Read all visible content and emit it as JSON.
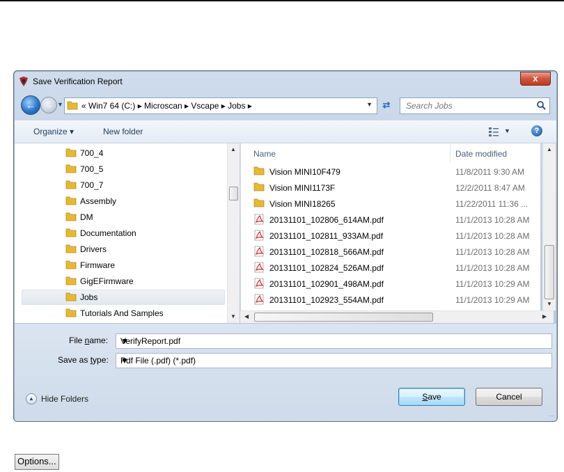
{
  "window": {
    "title": "Save Verification Report",
    "close_label": "x"
  },
  "address_bar": {
    "path": "«  Win7 64 (C:)  ▸  Microscan  ▸  Vscape  ▸  Jobs  ▸"
  },
  "search": {
    "placeholder": "Search Jobs"
  },
  "toolbar": {
    "organize_label": "Organize ▾",
    "new_folder_label": "New folder"
  },
  "nav_pane": {
    "items": [
      {
        "label": "700_4"
      },
      {
        "label": "700_5"
      },
      {
        "label": "700_7"
      },
      {
        "label": "Assembly"
      },
      {
        "label": "DM"
      },
      {
        "label": "Documentation"
      },
      {
        "label": "Drivers"
      },
      {
        "label": "Firmware"
      },
      {
        "label": "GigEFirmware"
      },
      {
        "label": "Jobs",
        "selected": true
      },
      {
        "label": "Tutorials And Samples"
      }
    ]
  },
  "file_list": {
    "columns": {
      "name": "Name",
      "date": "Date modified"
    },
    "rows": [
      {
        "name": "Vision MINI10F479",
        "date": "11/8/2011 9:30 AM",
        "type": "folder"
      },
      {
        "name": "Vision MINI1173F",
        "date": "12/2/2011 8:47 AM",
        "type": "folder"
      },
      {
        "name": "Vision MINI18265",
        "date": "11/22/2011 11:36 ...",
        "type": "folder"
      },
      {
        "name": "20131101_102806_614AM.pdf",
        "date": "11/1/2013 10:28 AM",
        "type": "pdf"
      },
      {
        "name": "20131101_102811_933AM.pdf",
        "date": "11/1/2013 10:28 AM",
        "type": "pdf"
      },
      {
        "name": "20131101_102818_566AM.pdf",
        "date": "11/1/2013 10:28 AM",
        "type": "pdf"
      },
      {
        "name": "20131101_102824_526AM.pdf",
        "date": "11/1/2013 10:28 AM",
        "type": "pdf"
      },
      {
        "name": "20131101_102901_498AM.pdf",
        "date": "11/1/2013 10:29 AM",
        "type": "pdf"
      },
      {
        "name": "20131101_102923_554AM.pdf",
        "date": "11/1/2013 10:29 AM",
        "type": "pdf"
      }
    ]
  },
  "form": {
    "file_name_label_pre": "File ",
    "file_name_label_key": "n",
    "file_name_label_post": "ame:",
    "file_name_value": "VerifyReport.pdf",
    "save_type_label_pre": "Save as ",
    "save_type_label_key": "t",
    "save_type_label_post": "ype:",
    "save_type_value": "Pdf File (.pdf) (*.pdf)"
  },
  "footer": {
    "hide_folders_label": "Hide Folders",
    "save_key": "S",
    "save_rest": "ave",
    "cancel_label": "Cancel"
  },
  "options_button": "Options..."
}
